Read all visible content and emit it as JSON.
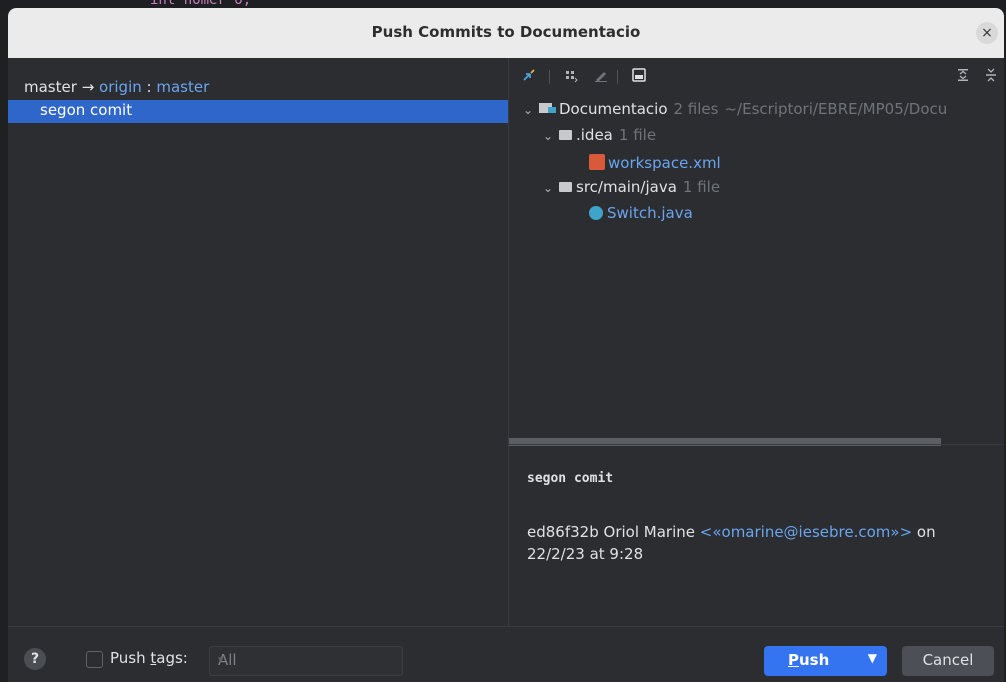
{
  "editor_fragment": "int nomer o;",
  "dialog": {
    "title": "Push Commits to Documentacio",
    "close_glyph": "×"
  },
  "left_panel": {
    "local_branch": "master",
    "arrow": "→",
    "remote": "origin",
    "separator": " : ",
    "remote_branch": "master",
    "commit": "segon comit"
  },
  "toolbar": {
    "icons": [
      "diff-arrows-icon",
      "group-by-icon",
      "edit-source-icon",
      "preview-icon",
      "expand-all-icon",
      "collapse-all-icon"
    ]
  },
  "tree": {
    "root": {
      "name": "Documentacio",
      "count": "2 files",
      "path": "~/Escriptori/EBRE/MP05/Docu"
    },
    "idea": {
      "name": ".idea",
      "count": "1 file"
    },
    "workspace": {
      "name": "workspace.xml"
    },
    "src": {
      "name": "src/main/java",
      "count": "1 file"
    },
    "switch": {
      "name": "Switch.java"
    }
  },
  "details": {
    "message": "segon comit",
    "hash": "ed86f32b",
    "author": "Oriol Marine",
    "email": "<«omarine@iesebre.com»>",
    "on": "on",
    "date": "22/2/23 at 9:28"
  },
  "bottom": {
    "help": "?",
    "push_tags_label_pre": "Push ",
    "push_tags_label_mnemonic": "t",
    "push_tags_label_post": "ags:",
    "tags_select_value": "All",
    "push_mnemonic": "P",
    "push_rest": "ush",
    "cancel": "Cancel"
  },
  "colors": {
    "accent": "#3574f0",
    "selection": "#2f66c9",
    "link": "#6aa4ef",
    "background": "#2b2d30"
  }
}
